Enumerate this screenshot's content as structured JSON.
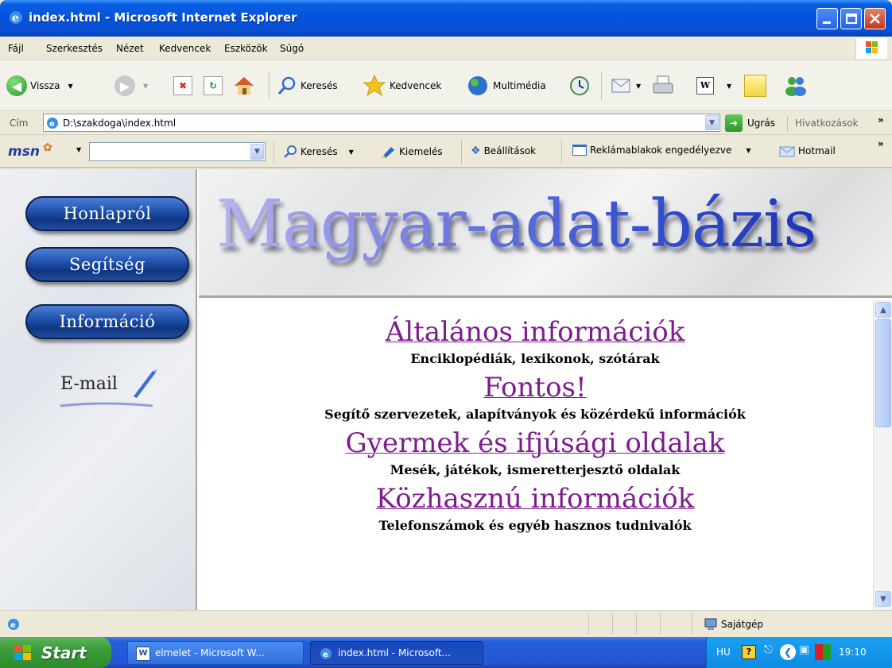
{
  "window": {
    "title": "index.html - Microsoft Internet Explorer"
  },
  "menu": [
    "Fájl",
    "Szerkesztés",
    "Nézet",
    "Kedvencek",
    "Eszközök",
    "Súgó"
  ],
  "toolbar": {
    "back": "Vissza",
    "search": "Keresés",
    "favorites": "Kedvencek",
    "media": "Multimédia"
  },
  "address": {
    "label": "Cím",
    "url": "D:\\szakdoga\\index.html",
    "go": "Ugrás",
    "links": "Hivatkozások"
  },
  "msn": {
    "logo": "msn",
    "search": "Keresés",
    "highlight": "Kiemelés",
    "settings": "Beállítások",
    "popups": "Reklámablakok engedélyezve",
    "hotmail": "Hotmail"
  },
  "page": {
    "banner": "Magyar-adat-bázis",
    "nav": [
      "Honlapról",
      "Segítség",
      "Információ"
    ],
    "email": "E-mail",
    "sections": [
      {
        "title": "Általános információk",
        "desc": "Enciklopédiák, lexikonok, szótárak"
      },
      {
        "title": "Fontos!",
        "desc": "Segítő szervezetek, alapítványok és közérdekű információk"
      },
      {
        "title": "Gyermek és ifjúsági oldalak",
        "desc": "Mesék, játékok, ismeretterjesztő oldalak"
      },
      {
        "title": "Közhasznú információk",
        "desc": "Telefonszámok és egyéb hasznos tudnivalók"
      }
    ]
  },
  "status": {
    "zone": "Sajátgép"
  },
  "taskbar": {
    "start": "Start",
    "tasks": [
      "elmelet - Microsoft W...",
      "index.html - Microsoft..."
    ],
    "lang": "HU",
    "clock": "19:10"
  },
  "colors": {
    "link": "#7E1B8E",
    "titlebar": "#0453DE",
    "navbutton": "#1E4FA8"
  }
}
